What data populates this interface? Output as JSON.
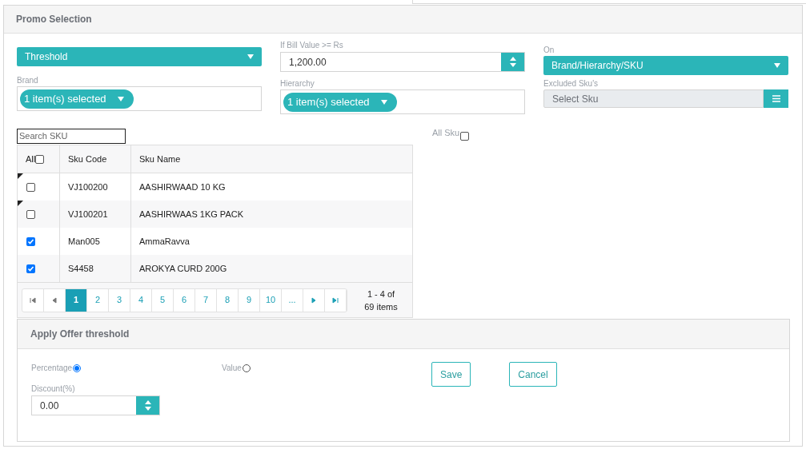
{
  "panel": {
    "title": "Promo Selection"
  },
  "promo_type": {
    "value": "Threshold"
  },
  "bill_value": {
    "label": "If Bill Value >= Rs",
    "value": "1,200.00"
  },
  "on": {
    "label": "On",
    "value": "Brand/Hierarchy/SKU"
  },
  "brand": {
    "label": "Brand",
    "chip": "1 item(s) selected"
  },
  "hierarchy": {
    "label": "Hierarchy",
    "chip": "1 item(s) selected"
  },
  "excluded": {
    "label": "Excluded Sku's",
    "placeholder": "Select Sku"
  },
  "search": {
    "placeholder": "Search SKU"
  },
  "all_sku": {
    "label": "All Sku",
    "checked": false
  },
  "table": {
    "select_all": {
      "label": "All",
      "checked": false
    },
    "columns": [
      "Sku Code",
      "Sku Name"
    ],
    "rows": [
      {
        "checked": false,
        "edited": true,
        "code": "VJ100200",
        "name": "AASHIRWAAD 10 KG"
      },
      {
        "checked": false,
        "edited": true,
        "code": "VJ100201",
        "name": "AASHIRWAAS 1KG PACK"
      },
      {
        "checked": true,
        "edited": false,
        "code": "Man005",
        "name": "AmmaRavva"
      },
      {
        "checked": true,
        "edited": false,
        "code": "S4458",
        "name": "AROKYA CURD 200G"
      }
    ]
  },
  "pagination": {
    "pages": [
      {
        "label": "1",
        "selected": true
      },
      {
        "label": "2",
        "selected": false
      },
      {
        "label": "3",
        "selected": false
      },
      {
        "label": "4",
        "selected": false
      },
      {
        "label": "5",
        "selected": false
      },
      {
        "label": "6",
        "selected": false
      },
      {
        "label": "7",
        "selected": false
      },
      {
        "label": "8",
        "selected": false
      },
      {
        "label": "9",
        "selected": false
      },
      {
        "label": "10",
        "selected": false
      },
      {
        "label": "...",
        "selected": false
      }
    ],
    "summary": "1 - 4 of 69 items"
  },
  "offer": {
    "title": "Apply Offer threshold",
    "options": [
      {
        "label": "Percentage",
        "selected": true
      },
      {
        "label": "Value",
        "selected": false
      }
    ],
    "discount": {
      "label": "Discount(%)",
      "value": "0.00"
    },
    "buttons": [
      "Save",
      "Cancel"
    ]
  }
}
